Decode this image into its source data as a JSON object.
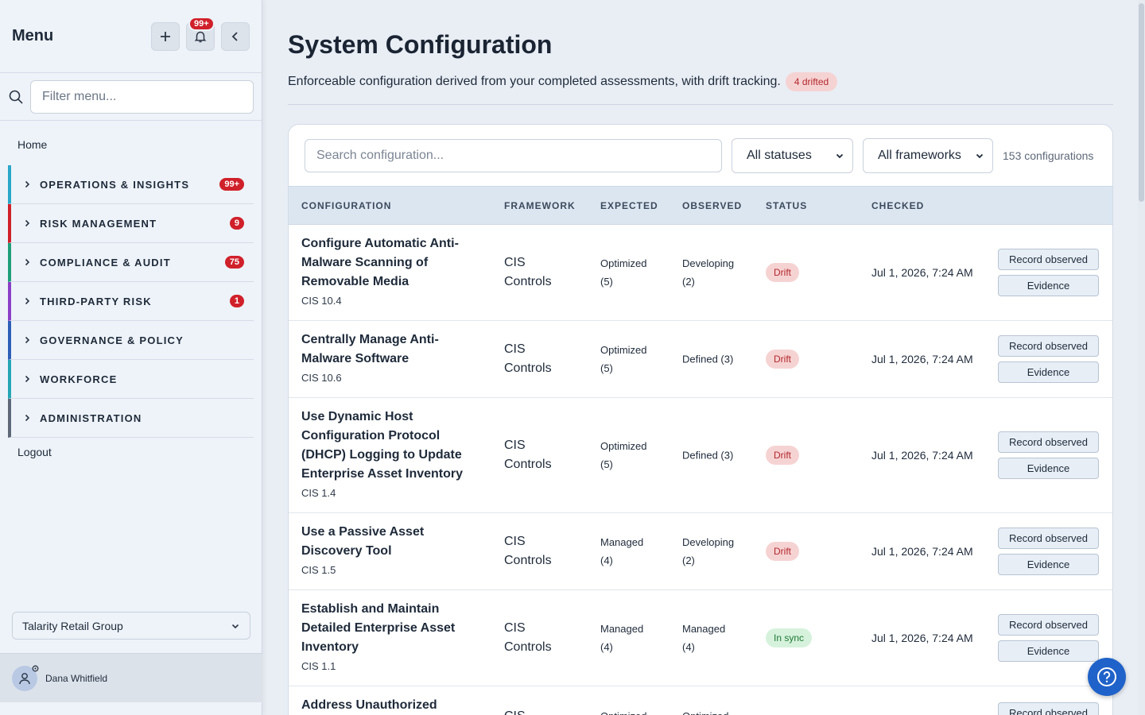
{
  "sidebar": {
    "title": "Menu",
    "notif_badge": "99+",
    "filter_placeholder": "Filter menu...",
    "home": "Home",
    "groups": [
      {
        "label": "OPERATIONS & INSIGHTS",
        "count": "99+",
        "color": "#2aa7c9"
      },
      {
        "label": "RISK MANAGEMENT",
        "count": "9",
        "color": "#d0202a"
      },
      {
        "label": "COMPLIANCE & AUDIT",
        "count": "75",
        "color": "#1f9e7a"
      },
      {
        "label": "THIRD-PARTY RISK",
        "count": "1",
        "color": "#8a3fc7"
      },
      {
        "label": "GOVERNANCE & POLICY",
        "count": "",
        "color": "#2e5fb8"
      },
      {
        "label": "WORKFORCE",
        "count": "",
        "color": "#25a6b5"
      },
      {
        "label": "ADMINISTRATION",
        "count": "",
        "color": "#5e6878"
      }
    ],
    "logout": "Logout",
    "org": "Talarity Retail Group",
    "user": "Dana Whitfield"
  },
  "main": {
    "title": "System Configuration",
    "subtitle": "Enforceable configuration derived from your completed assessments, with drift tracking.",
    "drift_pill": "4 drifted",
    "search_placeholder": "Search configuration...",
    "status_filter": "All statuses",
    "framework_filter": "All frameworks",
    "count_text": "153 configurations",
    "columns": [
      "CONFIGURATION",
      "FRAMEWORK",
      "EXPECTED",
      "OBSERVED",
      "STATUS",
      "CHECKED"
    ],
    "rows": [
      {
        "name": "Configure Automatic Anti-Malware Scanning of Removable Media",
        "name_lines": [
          "Configure Automatic Anti-",
          "Malware Scanning of",
          "Removable Media"
        ],
        "id": "CIS 10.4",
        "fw": [
          "CIS",
          "Controls"
        ],
        "expected": [
          "Optimized",
          "(5)"
        ],
        "observed": [
          "Developing",
          "(2)"
        ],
        "status": "Drift",
        "checked": "Jul 1, 2026, 7:24 AM"
      },
      {
        "name": "Centrally Manage Anti-Malware Software",
        "name_lines": [
          "Centrally Manage Anti-",
          "Malware Software"
        ],
        "id": "CIS 10.6",
        "fw": [
          "CIS",
          "Controls"
        ],
        "expected": [
          "Optimized",
          "(5)"
        ],
        "observed": [
          "Defined (3)"
        ],
        "status": "Drift",
        "checked": "Jul 1, 2026, 7:24 AM"
      },
      {
        "name": "Use Dynamic Host Configuration Protocol (DHCP) Logging to Update Enterprise Asset Inventory",
        "name_lines": [
          "Use Dynamic Host",
          "Configuration Protocol",
          "(DHCP) Logging to Update",
          "Enterprise Asset Inventory"
        ],
        "id": "CIS 1.4",
        "fw": [
          "CIS",
          "Controls"
        ],
        "expected": [
          "Optimized",
          "(5)"
        ],
        "observed": [
          "Defined (3)"
        ],
        "status": "Drift",
        "checked": "Jul 1, 2026, 7:24 AM"
      },
      {
        "name": "Use a Passive Asset Discovery Tool",
        "name_lines": [
          "Use a Passive Asset",
          "Discovery Tool"
        ],
        "id": "CIS 1.5",
        "fw": [
          "CIS",
          "Controls"
        ],
        "expected": [
          "Managed",
          "(4)"
        ],
        "observed": [
          "Developing",
          "(2)"
        ],
        "status": "Drift",
        "checked": "Jul 1, 2026, 7:24 AM"
      },
      {
        "name": "Establish and Maintain Detailed Enterprise Asset Inventory",
        "name_lines": [
          "Establish and Maintain",
          "Detailed Enterprise Asset",
          "Inventory"
        ],
        "id": "CIS 1.1",
        "fw": [
          "CIS",
          "Controls"
        ],
        "expected": [
          "Managed",
          "(4)"
        ],
        "observed": [
          "Managed",
          "(4)"
        ],
        "status": "In sync",
        "checked": "Jul 1, 2026, 7:24 AM"
      },
      {
        "name": "Address Unauthorized",
        "name_lines": [
          "Address Unauthorized"
        ],
        "id": "",
        "fw": [
          "CIS"
        ],
        "expected": [
          "Optimized"
        ],
        "observed": [
          "Optimized"
        ],
        "status": "",
        "checked": ""
      }
    ],
    "record_label": "Record observed",
    "evidence_label": "Evidence"
  }
}
